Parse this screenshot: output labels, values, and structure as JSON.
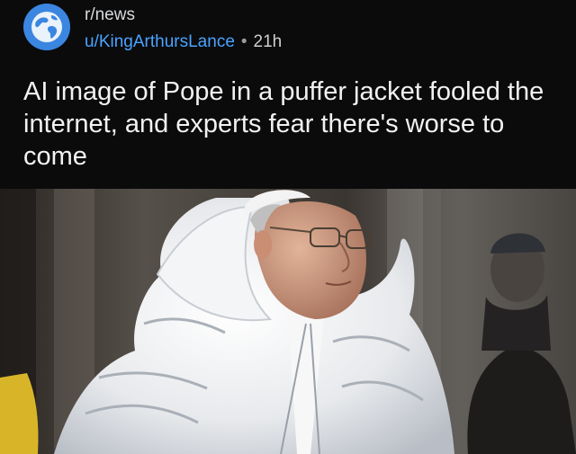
{
  "post": {
    "subreddit": "r/news",
    "username": "u/KingArthursLance",
    "separator": "•",
    "age": "21h",
    "title": "AI image of Pope in a puffer jacket fooled the internet, and experts fear there's worse to come"
  },
  "icons": {
    "avatar": "globe-icon"
  },
  "colors": {
    "background": "#0b0b0c",
    "username": "#4aa3ff",
    "avatar": "#3a7bd5",
    "title": "#f2f2f2"
  }
}
